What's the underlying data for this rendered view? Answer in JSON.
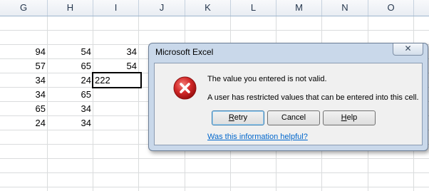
{
  "sheet": {
    "columns": [
      "G",
      "H",
      "I",
      "J",
      "K",
      "L",
      "M",
      "N",
      "O"
    ],
    "rows": [
      [
        "94",
        "54",
        "34"
      ],
      [
        "57",
        "65",
        "54"
      ],
      [
        "34",
        "24",
        ""
      ],
      [
        "34",
        "65",
        ""
      ],
      [
        "65",
        "34",
        ""
      ],
      [
        "24",
        "34",
        ""
      ]
    ],
    "active_cell_value": "222"
  },
  "dialog": {
    "title": "Microsoft Excel",
    "close_glyph": "✕",
    "icon": "error-icon",
    "message_line1": "The value you entered is not valid.",
    "message_line2": "A user has restricted values that can be entered into this cell.",
    "buttons": {
      "retry": {
        "accel": "R",
        "rest": "etry"
      },
      "cancel": "Cancel",
      "help": {
        "accel": "H",
        "rest": "elp"
      }
    },
    "help_link": "Was this information helpful?"
  },
  "colors": {
    "error_red": "#d42a2a",
    "link_blue": "#0066cc",
    "grid_line": "#dadcdd",
    "header_text": "#26374d"
  }
}
